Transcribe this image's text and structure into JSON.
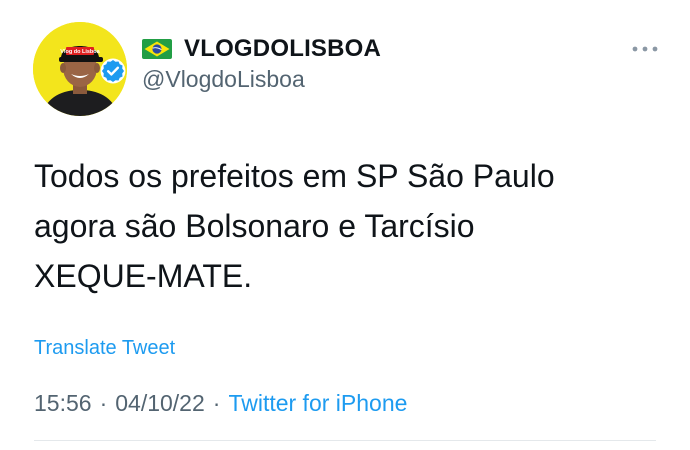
{
  "author": {
    "display_name": "VLOGDOLISBOA",
    "handle": "@VlogdoLisboa",
    "avatar_cap_text": "Vlog do Lisboa",
    "verified": true,
    "flag_icon": "brazil-flag-icon"
  },
  "tweet": {
    "text_lines": [
      "Todos os prefeitos em SP São Paulo",
      "agora são Bolsonaro e Tarcísio",
      "XEQUE-MATE."
    ],
    "translate_label": "Translate Tweet",
    "time": "15:56",
    "separator": "·",
    "date": "04/10/22",
    "source": "Twitter for iPhone"
  },
  "colors": {
    "accent": "#1d9bf0",
    "secondary_text": "#536471",
    "primary_text": "#0f1419",
    "avatar_bg": "#f3e51c"
  }
}
